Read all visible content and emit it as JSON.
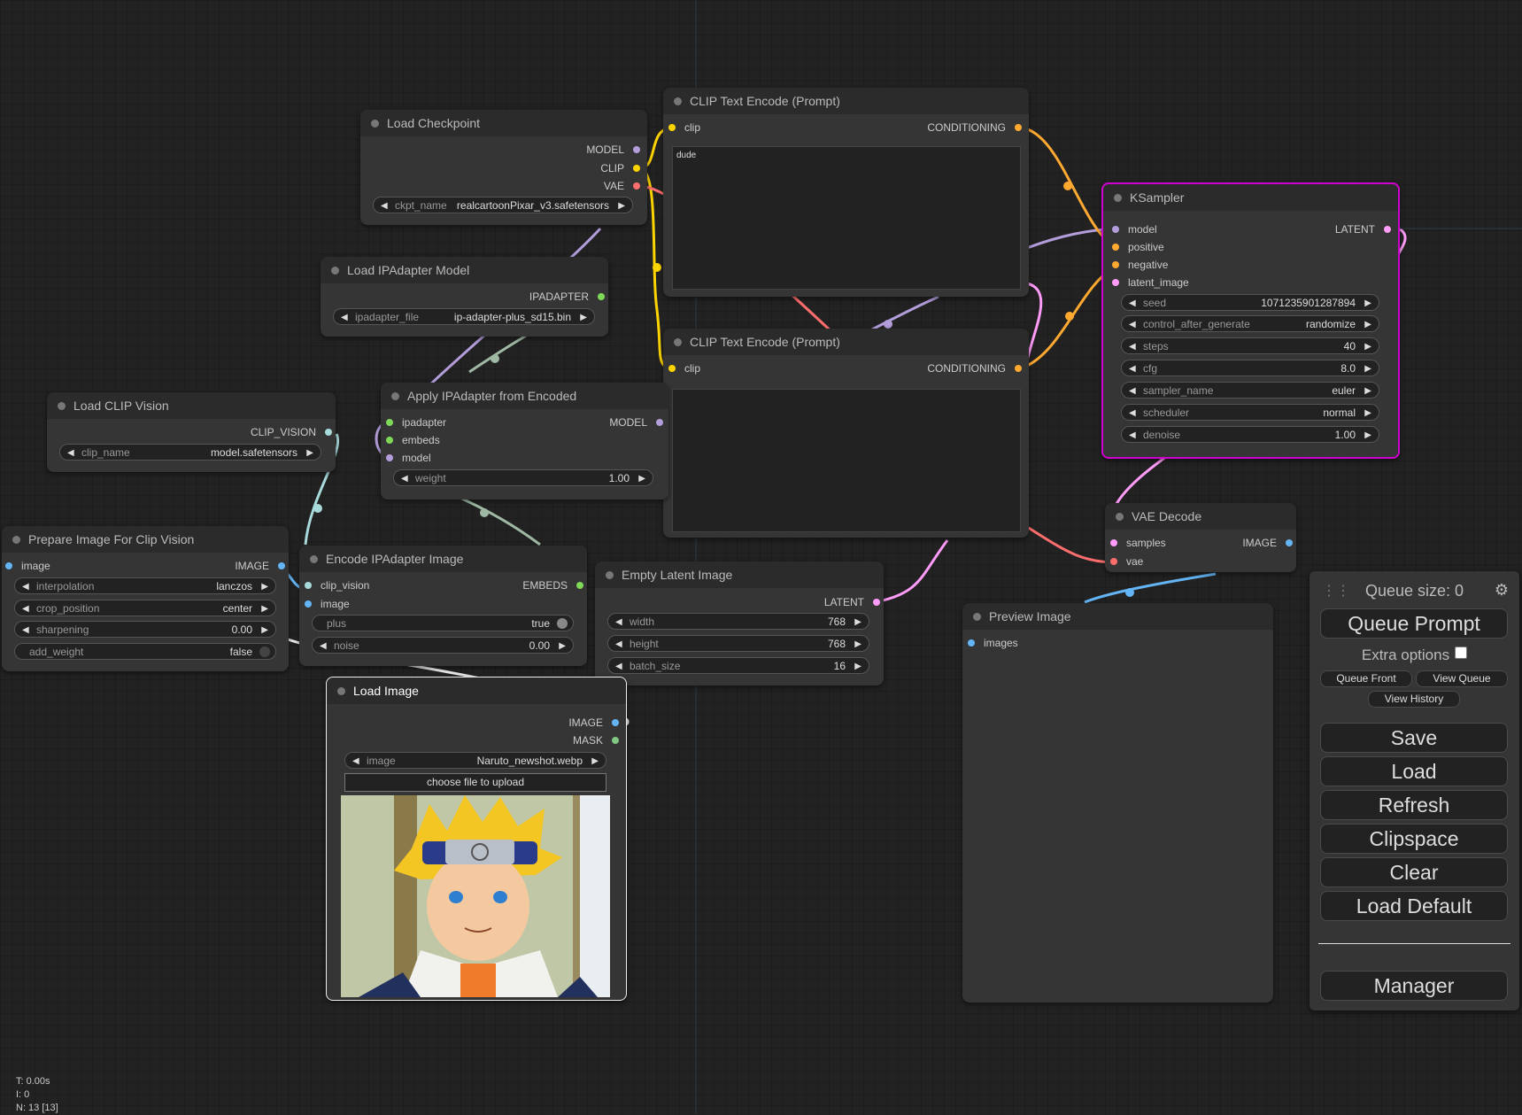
{
  "nodes": {
    "load_checkpoint": {
      "title": "Load Checkpoint",
      "outputs": [
        "MODEL",
        "CLIP",
        "VAE"
      ],
      "widget": {
        "label": "ckpt_name",
        "value": "realcartoonPixar_v3.safetensors"
      }
    },
    "clip_text_pos": {
      "title": "CLIP Text Encode (Prompt)",
      "input": "clip",
      "output": "CONDITIONING",
      "text": "dude"
    },
    "clip_text_neg": {
      "title": "CLIP Text Encode (Prompt)",
      "input": "clip",
      "output": "CONDITIONING",
      "text": ""
    },
    "ksampler": {
      "title": "KSampler",
      "inputs": [
        "model",
        "positive",
        "negative",
        "latent_image"
      ],
      "output": "LATENT",
      "widgets": [
        {
          "label": "seed",
          "value": "1071235901287894"
        },
        {
          "label": "control_after_generate",
          "value": "randomize"
        },
        {
          "label": "steps",
          "value": "40"
        },
        {
          "label": "cfg",
          "value": "8.0"
        },
        {
          "label": "sampler_name",
          "value": "euler"
        },
        {
          "label": "scheduler",
          "value": "normal"
        },
        {
          "label": "denoise",
          "value": "1.00"
        }
      ]
    },
    "load_ipadapter_model": {
      "title": "Load IPAdapter Model",
      "output": "IPADAPTER",
      "widget": {
        "label": "ipadapter_file",
        "value": "ip-adapter-plus_sd15.bin"
      }
    },
    "apply_ipadapter": {
      "title": "Apply IPAdapter from Encoded",
      "inputs": [
        "ipadapter",
        "embeds",
        "model"
      ],
      "output": "MODEL",
      "widget": {
        "label": "weight",
        "value": "1.00"
      }
    },
    "load_clip_vision": {
      "title": "Load CLIP Vision",
      "output": "CLIP_VISION",
      "widget": {
        "label": "clip_name",
        "value": "model.safetensors"
      }
    },
    "prepare_image": {
      "title": "Prepare Image For Clip Vision",
      "input": "image",
      "output": "IMAGE",
      "widgets": [
        {
          "label": "interpolation",
          "value": "lanczos"
        },
        {
          "label": "crop_position",
          "value": "center"
        },
        {
          "label": "sharpening",
          "value": "0.00"
        }
      ],
      "toggle": {
        "label": "add_weight",
        "value": "false"
      }
    },
    "encode_ipadapter": {
      "title": "Encode IPAdapter Image",
      "inputs": [
        "clip_vision",
        "image"
      ],
      "output": "EMBEDS",
      "toggle": {
        "label": "plus",
        "value": "true"
      },
      "widget": {
        "label": "noise",
        "value": "0.00"
      }
    },
    "empty_latent": {
      "title": "Empty Latent Image",
      "output": "LATENT",
      "widgets": [
        {
          "label": "width",
          "value": "768"
        },
        {
          "label": "height",
          "value": "768"
        },
        {
          "label": "batch_size",
          "value": "16"
        }
      ]
    },
    "vae_decode": {
      "title": "VAE Decode",
      "inputs": [
        "samples",
        "vae"
      ],
      "output": "IMAGE"
    },
    "preview_image": {
      "title": "Preview Image",
      "input": "images"
    },
    "load_image": {
      "title": "Load Image",
      "outputs": [
        "IMAGE",
        "MASK"
      ],
      "widget": {
        "label": "image",
        "value": "Naruto_newshot.webp"
      },
      "upload_label": "choose file to upload"
    }
  },
  "slot_colors": {
    "MODEL": "#b39ddb",
    "CLIP": "#ffd500",
    "VAE": "#ff6e6e",
    "CONDITIONING": "#ffa931",
    "LATENT": "#ff9cf9",
    "IMAGE": "#64b5f6",
    "MASK": "#81c784",
    "CLIP_VISION": "#a8dadc",
    "IPADAPTER": "#7ed957",
    "EMBEDS": "#7ed957"
  },
  "menu": {
    "queue_size": "Queue size: 0",
    "queue_prompt": "Queue Prompt",
    "extra_options": "Extra options",
    "queue_front": "Queue Front",
    "view_queue": "View Queue",
    "view_history": "View History",
    "save": "Save",
    "load": "Load",
    "refresh": "Refresh",
    "clipspace": "Clipspace",
    "clear": "Clear",
    "load_default": "Load Default",
    "manager": "Manager"
  },
  "stats": {
    "t": "T: 0.00s",
    "i": "I: 0",
    "n": "N: 13 [13]"
  },
  "selected_node_color": "#d000d0"
}
